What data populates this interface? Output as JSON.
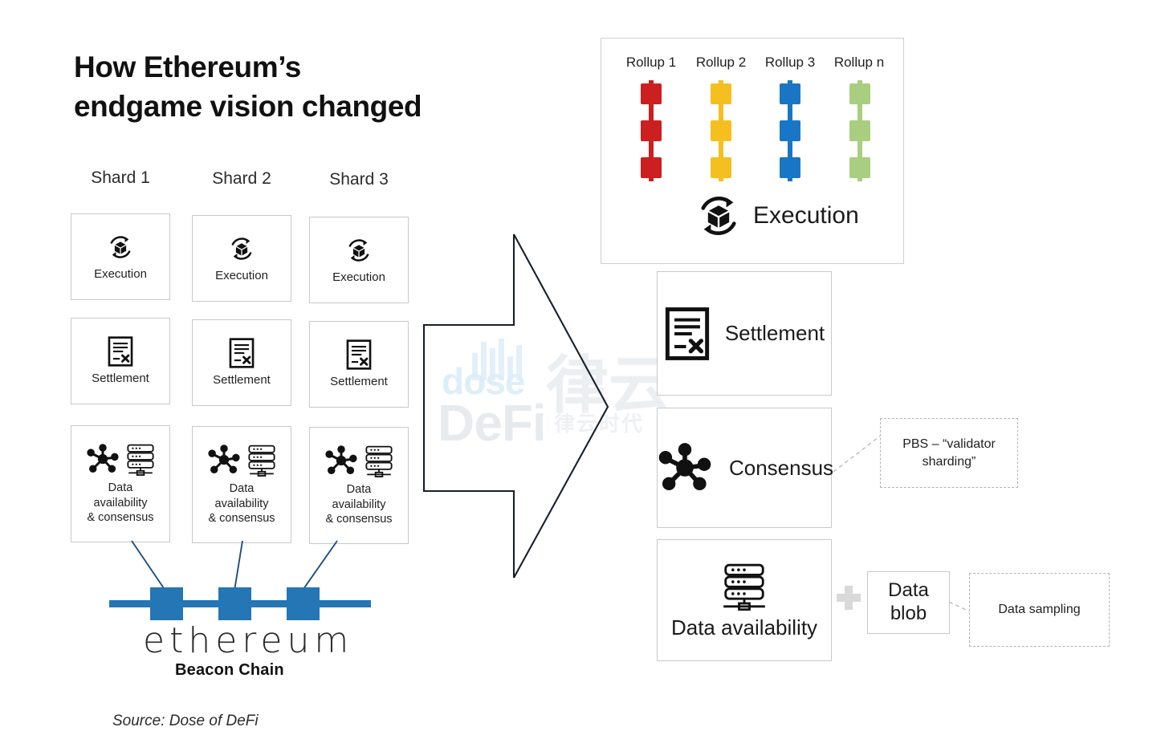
{
  "title": {
    "line1": "How Ethereum’s",
    "line2": "endgame vision changed"
  },
  "source": "Source: Dose of DeFi",
  "colors": {
    "beacon_blue": "#2576b5",
    "connector_navy": "#1f4e79",
    "rollup_1": "#cc1f1f",
    "rollup_2": "#f5c01f",
    "rollup_3": "#1976c4",
    "rollup_n": "#a9ce7f",
    "card_border": "#c9c9c9",
    "dashed_border": "#b4b4b4"
  },
  "left": {
    "shard_headers": [
      "Shard 1",
      "Shard 2",
      "Shard 3"
    ],
    "rows": [
      {
        "icon": "execution-cycle-icon",
        "label": "Execution"
      },
      {
        "icon": "settlement-document-icon",
        "label": "Settlement"
      },
      {
        "icon": "network-plus-server-icon",
        "label": "Data\navailability\n& consensus"
      }
    ],
    "cells": [
      [
        {
          "icon": "execution-cycle-icon",
          "label": "Execution"
        },
        {
          "icon": "execution-cycle-icon",
          "label": "Execution"
        },
        {
          "icon": "execution-cycle-icon",
          "label": "Execution"
        }
      ],
      [
        {
          "icon": "settlement-document-icon",
          "label": "Settlement"
        },
        {
          "icon": "settlement-document-icon",
          "label": "Settlement"
        },
        {
          "icon": "settlement-document-icon",
          "label": "Settlement"
        }
      ],
      [
        {
          "icon": "network-plus-server-icon",
          "line1": "Data",
          "line2": "availability",
          "line3": "& consensus"
        },
        {
          "icon": "network-plus-server-icon",
          "line1": "Data",
          "line2": "availability",
          "line3": "& consensus"
        },
        {
          "icon": "network-plus-server-icon",
          "line1": "Data",
          "line2": "availability",
          "line3": "& consensus"
        }
      ]
    ],
    "beacon": {
      "wordmark": "ethereum",
      "label": "Beacon Chain",
      "block_count": 3
    }
  },
  "watermark": {
    "text_top": "dose",
    "text_bottom": "DeFi",
    "cn_main": "律云",
    "cn_sub": "律云时代"
  },
  "right": {
    "rollup_panel": {
      "labels": [
        "Rollup 1",
        "Rollup 2",
        "Rollup 3",
        "Rollup n"
      ],
      "chain_colors": [
        "#cc1f1f",
        "#f5c01f",
        "#1976c4",
        "#a9ce7f"
      ],
      "blocks_per_chain": 3,
      "execution": {
        "icon": "execution-cycle-icon",
        "label": "Execution"
      }
    },
    "panels": [
      {
        "icon": "settlement-document-icon",
        "label": "Settlement"
      },
      {
        "icon": "network-star-icon",
        "label": "Consensus"
      },
      {
        "icon": "server-stack-icon",
        "label": "Data availability"
      }
    ],
    "annotations": [
      {
        "line1": "PBS – “validator",
        "line2": "sharding”"
      },
      {
        "line1": "Data sampling",
        "line2": ""
      }
    ],
    "data_blob": {
      "line1": "Data",
      "line2": "blob"
    },
    "plus": "+"
  }
}
